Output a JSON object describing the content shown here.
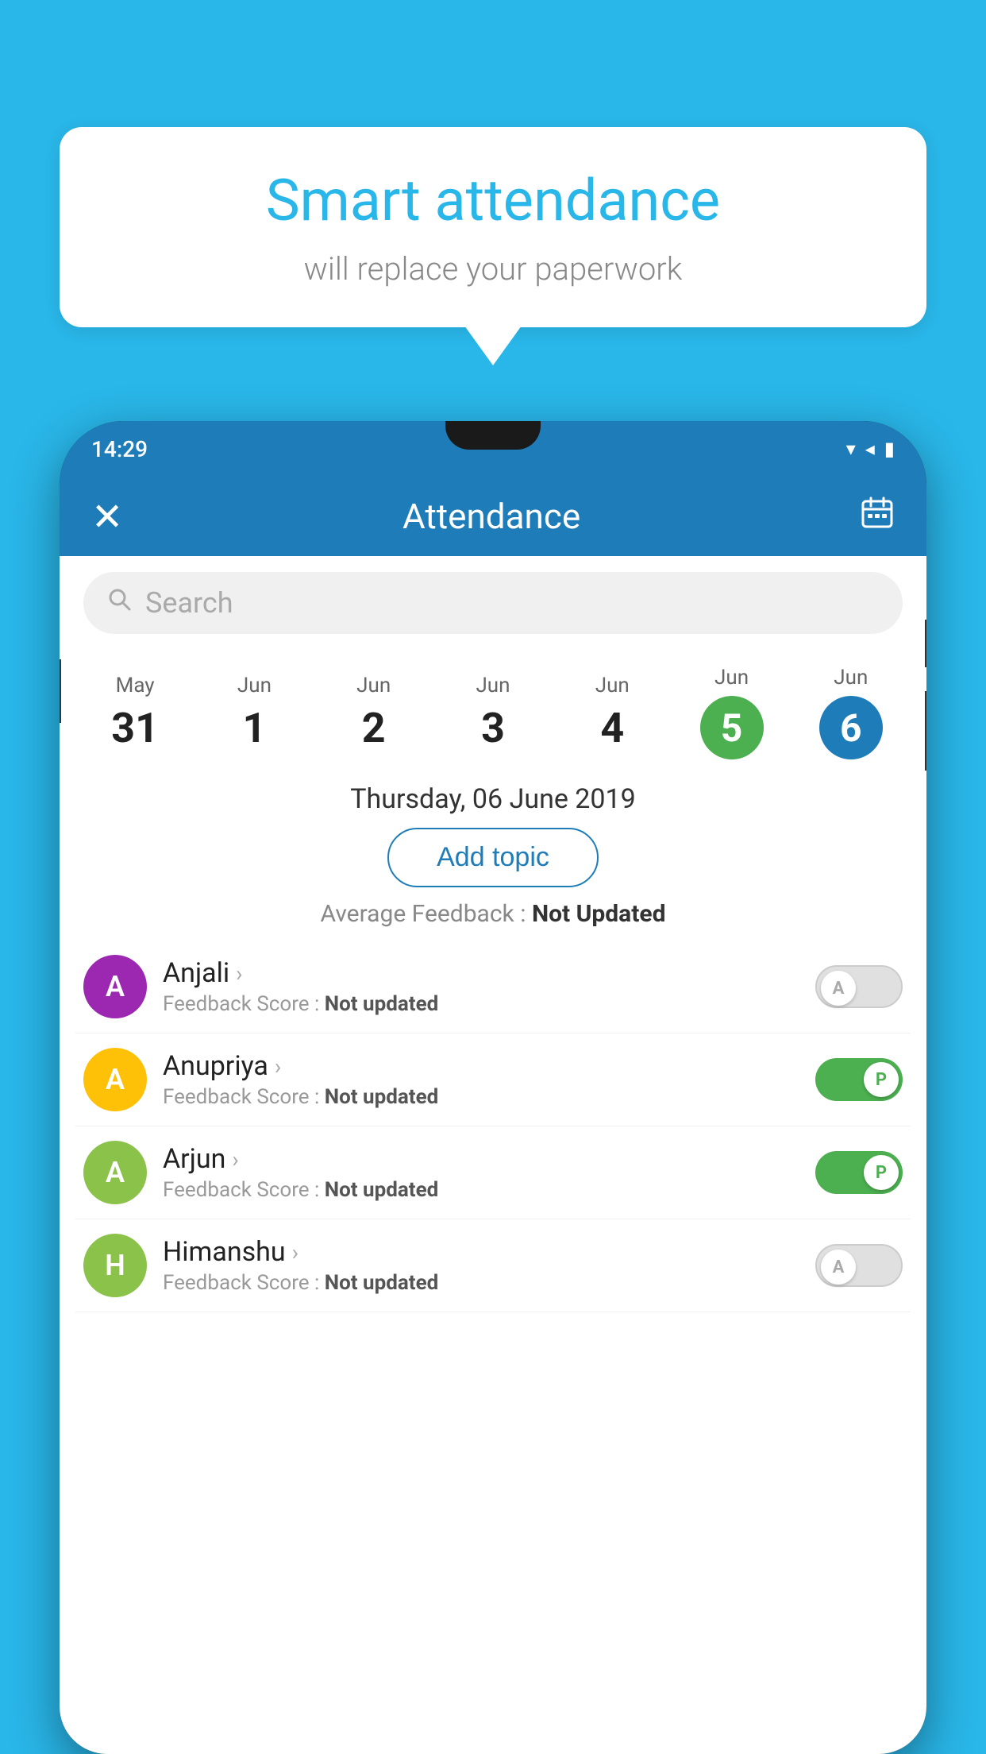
{
  "page": {
    "background_color": "#29B6E8"
  },
  "bubble": {
    "title": "Smart attendance",
    "subtitle": "will replace your paperwork"
  },
  "status_bar": {
    "time": "14:29",
    "wifi_icon": "▼",
    "signal_icon": "◀",
    "battery_icon": "▮"
  },
  "app_header": {
    "close_label": "✕",
    "title": "Attendance",
    "calendar_icon": "📅"
  },
  "search": {
    "placeholder": "Search"
  },
  "dates": [
    {
      "month": "May",
      "day": "31",
      "selected": false
    },
    {
      "month": "Jun",
      "day": "1",
      "selected": false
    },
    {
      "month": "Jun",
      "day": "2",
      "selected": false
    },
    {
      "month": "Jun",
      "day": "3",
      "selected": false
    },
    {
      "month": "Jun",
      "day": "4",
      "selected": false
    },
    {
      "month": "Jun",
      "day": "5",
      "selected": "green"
    },
    {
      "month": "Jun",
      "day": "6",
      "selected": "blue"
    }
  ],
  "selected_date_label": "Thursday, 06 June 2019",
  "add_topic_label": "Add topic",
  "average_feedback_label": "Average Feedback :",
  "average_feedback_value": "Not Updated",
  "students": [
    {
      "name": "Anjali",
      "avatar_letter": "A",
      "avatar_color": "#9C27B0",
      "feedback_label": "Feedback Score :",
      "feedback_value": "Not updated",
      "toggle_state": "off",
      "toggle_label": "A"
    },
    {
      "name": "Anupriya",
      "avatar_letter": "A",
      "avatar_color": "#FFC107",
      "feedback_label": "Feedback Score :",
      "feedback_value": "Not updated",
      "toggle_state": "on",
      "toggle_label": "P"
    },
    {
      "name": "Arjun",
      "avatar_letter": "A",
      "avatar_color": "#8BC34A",
      "feedback_label": "Feedback Score :",
      "feedback_value": "Not updated",
      "toggle_state": "on",
      "toggle_label": "P"
    },
    {
      "name": "Himanshu",
      "avatar_letter": "H",
      "avatar_color": "#8BC34A",
      "feedback_label": "Feedback Score :",
      "feedback_value": "Not updated",
      "toggle_state": "off",
      "toggle_label": "A"
    }
  ]
}
